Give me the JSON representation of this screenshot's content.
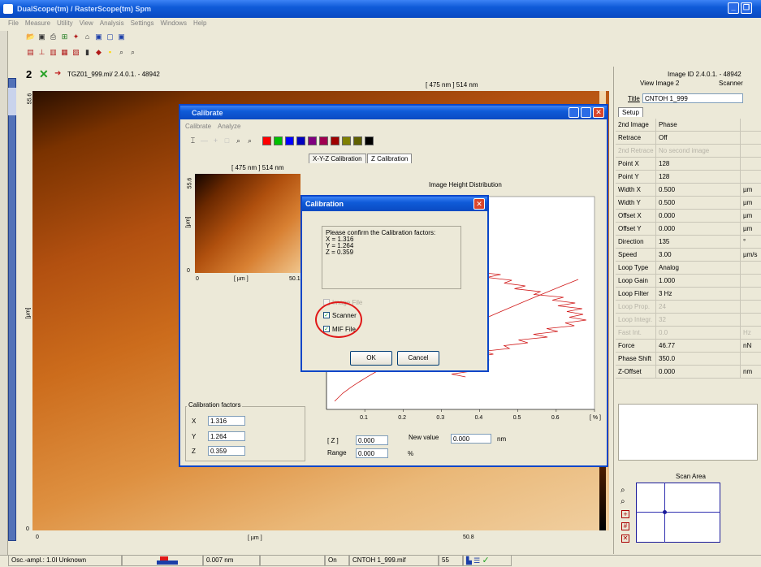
{
  "app": {
    "title": "DualScope(tm) / RasterScope(tm) Spm",
    "menu": [
      "File",
      "Measure",
      "Utility",
      "View",
      "Analysis",
      "Settings",
      "Windows",
      "Help"
    ]
  },
  "image_header": {
    "number": "2",
    "filename": "TGZ01_999.mi/ 2.4.0.1. - 48942",
    "size_label": "[ 475 nm ] 514 nm"
  },
  "main_image": {
    "y_top": "55.6",
    "y_bottom": "0",
    "y_unit": "[µm]",
    "x_left": "0",
    "x_right": "50.8",
    "x_unit": "[ µm ]"
  },
  "right_panel": {
    "image_id": "Image ID 2.4.0.1. - 48942",
    "view_image": "View Image 2",
    "scanner_tab": "Scanner",
    "title_label": "Title",
    "title_value": "CNTOH 1_999",
    "setup_tab": "Setup",
    "params": [
      {
        "k": "2nd Image",
        "v": "Phase",
        "u": ""
      },
      {
        "k": "Retrace",
        "v": "Off",
        "u": ""
      },
      {
        "k": "2nd Retrace",
        "v": "No second image",
        "u": "",
        "dis": true
      },
      {
        "k": "Point X",
        "v": "128",
        "u": ""
      },
      {
        "k": "Point Y",
        "v": "128",
        "u": ""
      },
      {
        "k": "Width X",
        "v": "0.500",
        "u": "µm"
      },
      {
        "k": "Width Y",
        "v": "0.500",
        "u": "µm"
      },
      {
        "k": "Offset X",
        "v": "0.000",
        "u": "µm"
      },
      {
        "k": "Offset Y",
        "v": "0.000",
        "u": "µm"
      },
      {
        "k": "Direction",
        "v": "135",
        "u": "°"
      },
      {
        "k": "Speed",
        "v": "3.00",
        "u": "µm/s"
      },
      {
        "k": "Loop Type",
        "v": "Analog",
        "u": ""
      },
      {
        "k": "Loop Gain",
        "v": "1.000",
        "u": ""
      },
      {
        "k": "Loop Filter",
        "v": "3 Hz",
        "u": ""
      },
      {
        "k": "Loop Prop.",
        "v": "24",
        "u": "",
        "dis": true
      },
      {
        "k": "Loop Integr.",
        "v": "32",
        "u": "",
        "dis": true
      },
      {
        "k": "Fast Int.",
        "v": "0.0",
        "u": "Hz",
        "dis": true
      },
      {
        "k": "Force",
        "v": "46.77",
        "u": "nN"
      },
      {
        "k": "Phase Shift",
        "v": "350.0",
        "u": ""
      },
      {
        "k": "Z-Offset",
        "v": "0.000",
        "u": "nm"
      }
    ],
    "scan_area_label": "Scan Area"
  },
  "calibrate": {
    "title": "Calibrate",
    "menu": [
      "Calibrate",
      "Analyze"
    ],
    "size_label": "[ 475 nm ] 514 nm",
    "thumb_y_top": "55.6",
    "thumb_y_unit": "[µm]",
    "thumb_y_bottom": "0",
    "thumb_x_left": "0",
    "thumb_x_unit": "[ µm ]",
    "thumb_x_right": "50.1",
    "tab_xyz": "X-Y-Z Calibration",
    "tab_z": "Z Calibration",
    "factors_label": "Calibration factors",
    "fx_label": "X",
    "fy_label": "Y",
    "fz_label": "Z",
    "fx": "1.316",
    "fy": "1.264",
    "fz": "0.359",
    "z_label": "[ Z ]",
    "z_value": "0.000",
    "range_label": "Range",
    "range_value": "0.000",
    "range_unit": "%",
    "newval_label": "New value",
    "newval_value": "0.000",
    "newval_unit": "nm",
    "colors": [
      "#ff0000",
      "#00c000",
      "#0000ff",
      "#0000c0",
      "#800080",
      "#a00050",
      "#a00000",
      "#808000",
      "#606000",
      "#000000"
    ]
  },
  "chart_data": {
    "type": "line",
    "title": "Image Height Distribution",
    "xlabel": "[ % ]",
    "x_ticks": [
      "0.1",
      "0.2",
      "0.3",
      "0.4",
      "0.5",
      "0.6",
      "[ % ]"
    ],
    "xlim": [
      0,
      0.7
    ]
  },
  "dialog": {
    "title": "Calibration",
    "message_lines": [
      "Please confirm the Calibration factors:",
      "X = 1.316",
      "Y = 1.264",
      "Z = 0.359"
    ],
    "image_file": "Image File",
    "scanner": "Scanner",
    "mif_file": "MIF File",
    "ok": "OK",
    "cancel": "Cancel"
  },
  "status": {
    "osc": "Osc.-ampl.: 1.0I Unknown",
    "value": "0.007 nm",
    "on": "On",
    "file": "CNTOH 1_999.mif",
    "num": "55"
  }
}
